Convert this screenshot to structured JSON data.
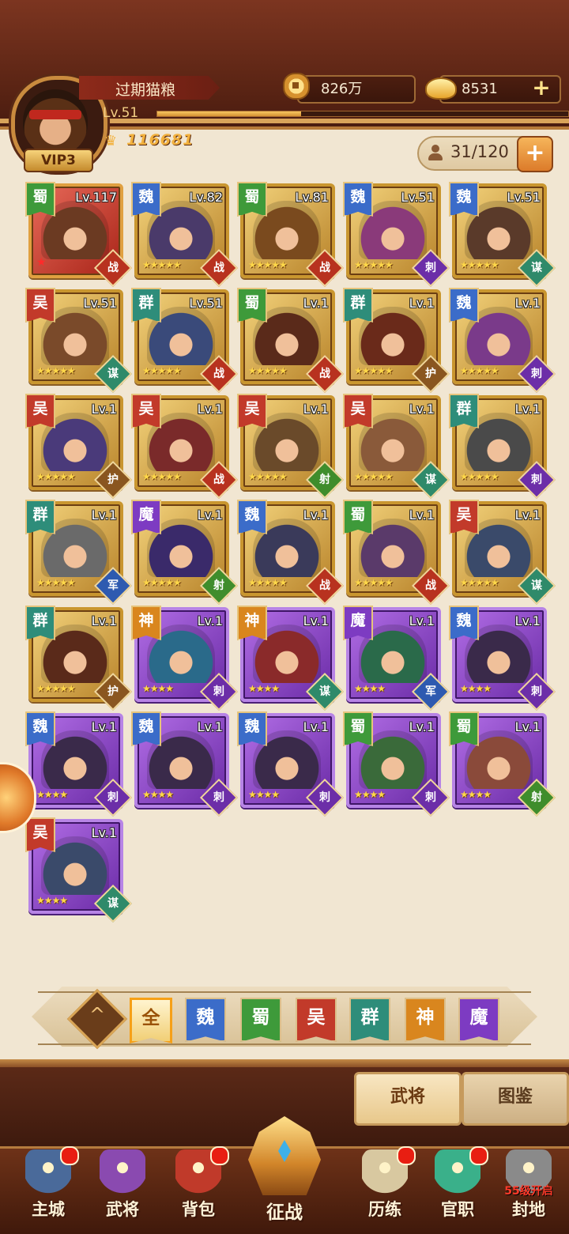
{
  "player": {
    "name": "过期猫粮",
    "level": "Lv.51",
    "vip": "VIP3",
    "power": "116681",
    "exp_progress": 0.35
  },
  "resources": {
    "copper": "826万",
    "gold": "8531",
    "add_label": "+"
  },
  "roster": {
    "capacity": "31/120",
    "add_label": "+"
  },
  "heroes": [
    {
      "faction": "蜀",
      "level": "Lv.117",
      "stars": "",
      "role": "战",
      "rarity": "red"
    },
    {
      "faction": "魏",
      "level": "Lv.82",
      "stars": "★★★★★",
      "role": "战",
      "rarity": "gold"
    },
    {
      "faction": "蜀",
      "level": "Lv.81",
      "stars": "★★★★★",
      "role": "战",
      "rarity": "gold"
    },
    {
      "faction": "魏",
      "level": "Lv.51",
      "stars": "★★★★★",
      "role": "刺",
      "rarity": "gold"
    },
    {
      "faction": "魏",
      "level": "Lv.51",
      "stars": "★★★★★",
      "role": "谋",
      "rarity": "gold"
    },
    {
      "faction": "吴",
      "level": "Lv.51",
      "stars": "★★★★★",
      "role": "谋",
      "rarity": "gold"
    },
    {
      "faction": "群",
      "level": "Lv.51",
      "stars": "★★★★★",
      "role": "战",
      "rarity": "gold"
    },
    {
      "faction": "蜀",
      "level": "Lv.1",
      "stars": "★★★★★",
      "role": "战",
      "rarity": "gold"
    },
    {
      "faction": "群",
      "level": "Lv.1",
      "stars": "★★★★★",
      "role": "护",
      "rarity": "gold"
    },
    {
      "faction": "魏",
      "level": "Lv.1",
      "stars": "★★★★★",
      "role": "刺",
      "rarity": "gold"
    },
    {
      "faction": "吴",
      "level": "Lv.1",
      "stars": "★★★★★",
      "role": "护",
      "rarity": "gold"
    },
    {
      "faction": "吴",
      "level": "Lv.1",
      "stars": "★★★★★",
      "role": "战",
      "rarity": "gold"
    },
    {
      "faction": "吴",
      "level": "Lv.1",
      "stars": "★★★★★",
      "role": "射",
      "rarity": "gold"
    },
    {
      "faction": "吴",
      "level": "Lv.1",
      "stars": "★★★★★",
      "role": "谋",
      "rarity": "gold"
    },
    {
      "faction": "群",
      "level": "Lv.1",
      "stars": "★★★★★",
      "role": "刺",
      "rarity": "gold"
    },
    {
      "faction": "群",
      "level": "Lv.1",
      "stars": "★★★★★",
      "role": "军",
      "rarity": "gold"
    },
    {
      "faction": "魔",
      "level": "Lv.1",
      "stars": "★★★★★",
      "role": "射",
      "rarity": "gold"
    },
    {
      "faction": "魏",
      "level": "Lv.1",
      "stars": "★★★★★",
      "role": "战",
      "rarity": "gold"
    },
    {
      "faction": "蜀",
      "level": "Lv.1",
      "stars": "★★★★★",
      "role": "战",
      "rarity": "gold"
    },
    {
      "faction": "吴",
      "level": "Lv.1",
      "stars": "★★★★★",
      "role": "谋",
      "rarity": "gold"
    },
    {
      "faction": "群",
      "level": "Lv.1",
      "stars": "★★★★★",
      "role": "护",
      "rarity": "gold"
    },
    {
      "faction": "神",
      "level": "Lv.1",
      "stars": "★★★★",
      "role": "刺",
      "rarity": "purple"
    },
    {
      "faction": "神",
      "level": "Lv.1",
      "stars": "★★★★",
      "role": "谋",
      "rarity": "purple"
    },
    {
      "faction": "魔",
      "level": "Lv.1",
      "stars": "★★★★",
      "role": "军",
      "rarity": "purple"
    },
    {
      "faction": "魏",
      "level": "Lv.1",
      "stars": "★★★★",
      "role": "刺",
      "rarity": "purple"
    },
    {
      "faction": "魏",
      "level": "Lv.1",
      "stars": "★★★★",
      "role": "刺",
      "rarity": "purple"
    },
    {
      "faction": "魏",
      "level": "Lv.1",
      "stars": "★★★★",
      "role": "刺",
      "rarity": "purple"
    },
    {
      "faction": "魏",
      "level": "Lv.1",
      "stars": "★★★★",
      "role": "刺",
      "rarity": "purple"
    },
    {
      "faction": "蜀",
      "level": "Lv.1",
      "stars": "★★★★",
      "role": "刺",
      "rarity": "purple"
    },
    {
      "faction": "蜀",
      "level": "Lv.1",
      "stars": "★★★★",
      "role": "射",
      "rarity": "purple"
    },
    {
      "faction": "吴",
      "level": "Lv.1",
      "stars": "★★★★",
      "role": "谋",
      "rarity": "purple"
    }
  ],
  "filters": {
    "tabs": [
      {
        "label": "全",
        "active": true,
        "color": "#f1cf76"
      },
      {
        "label": "魏",
        "active": false,
        "color": "#3b6cc9"
      },
      {
        "label": "蜀",
        "active": false,
        "color": "#3e9a3a"
      },
      {
        "label": "吴",
        "active": false,
        "color": "#c23a2a"
      },
      {
        "label": "群",
        "active": false,
        "color": "#2e8d7a"
      },
      {
        "label": "神",
        "active": false,
        "color": "#d9861e"
      },
      {
        "label": "魔",
        "active": false,
        "color": "#7d3bc2"
      }
    ]
  },
  "subtabs": {
    "heroes": "武将",
    "codex": "图鉴"
  },
  "nav": {
    "items": [
      {
        "label": "主城",
        "badge": true
      },
      {
        "label": "武将",
        "badge": false
      },
      {
        "label": "背包",
        "badge": true
      },
      {
        "label": "征战",
        "badge": false
      },
      {
        "label": "历练",
        "badge": true
      },
      {
        "label": "官职",
        "badge": true
      },
      {
        "label": "封地",
        "badge": false,
        "lock": "55级开启"
      }
    ]
  }
}
